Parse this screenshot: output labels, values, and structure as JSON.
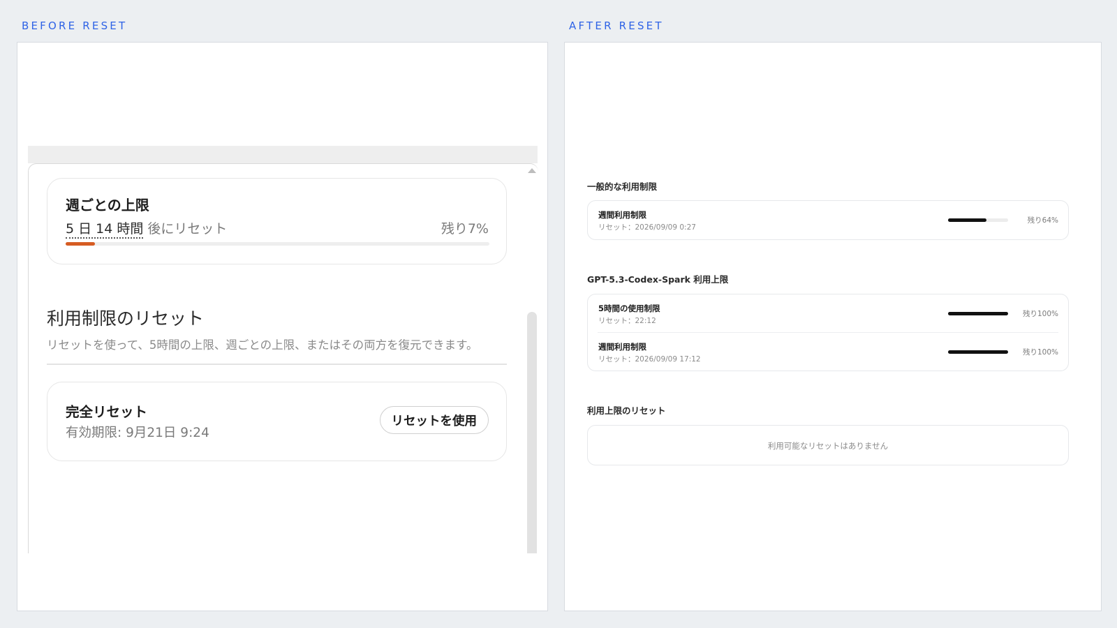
{
  "before": {
    "label": "BEFORE RESET",
    "weekly": {
      "title": "週ごとの上限",
      "reset_time": "5 日 14 時間",
      "reset_suffix": " 後にリセット",
      "remaining": "残り7%",
      "remaining_fraction": 0.07
    },
    "section": {
      "title": "利用制限のリセット",
      "description": "リセットを使って、5時間の上限、週ごとの上限、またはその両方を復元できます。"
    },
    "full_reset": {
      "title": "完全リセット",
      "expiry": "有効期限: 9月21日 9:24",
      "button": "リセットを使用"
    }
  },
  "after": {
    "label": "AFTER RESET",
    "general": {
      "heading": "一般的な利用制限",
      "rows": [
        {
          "title": "週間利用制限",
          "sub": "リセット：2026/09/09 0:27",
          "remaining": "残り64%",
          "fraction": 0.64
        }
      ]
    },
    "spark": {
      "heading": "GPT-5.3-Codex-Spark 利用上限",
      "rows": [
        {
          "title": "5時間の使用制限",
          "sub": "リセット：22:12",
          "remaining": "残り100%",
          "fraction": 1.0
        },
        {
          "title": "週間利用制限",
          "sub": "リセット：2026/09/09 17:12",
          "remaining": "残り100%",
          "fraction": 1.0
        }
      ]
    },
    "resets": {
      "heading": "利用上限のリセット",
      "empty": "利用可能なリセットはありません"
    }
  },
  "colors": {
    "accent_label": "#2f63e6",
    "progress_low": "#d65c22",
    "progress_dark": "#111111"
  }
}
